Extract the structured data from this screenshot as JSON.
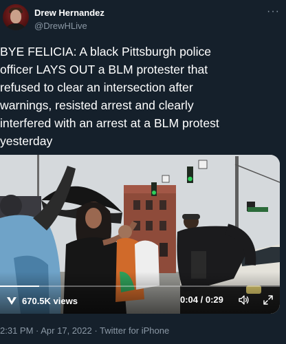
{
  "author": {
    "name": "Drew Hernandez",
    "handle": "@DrewHLive"
  },
  "tweet": {
    "text": "BYE FELICIA: A black Pittsburgh police\nofficer LAYS OUT a BLM protester that\nrefused to clear an intersection after\nwarnings, resisted arrest and clearly\ninterfered with an arrest at a BLM protest\nyesterday"
  },
  "video": {
    "views": "670.5K views",
    "time": "0:04 / 0:29",
    "progress": 0.14
  },
  "meta": {
    "time": "2:31 PM",
    "separator1": " · ",
    "date": "Apr 17, 2022",
    "separator2": " · ",
    "source": "Twitter for iPhone"
  },
  "icons": {
    "more": "more-icon",
    "views": "views-icon",
    "volume": "volume-icon",
    "fullscreen": "fullscreen-icon"
  },
  "colors": {
    "background": "#15202b",
    "secondary_text": "#8b98a5",
    "primary_text": "#ffffff"
  }
}
